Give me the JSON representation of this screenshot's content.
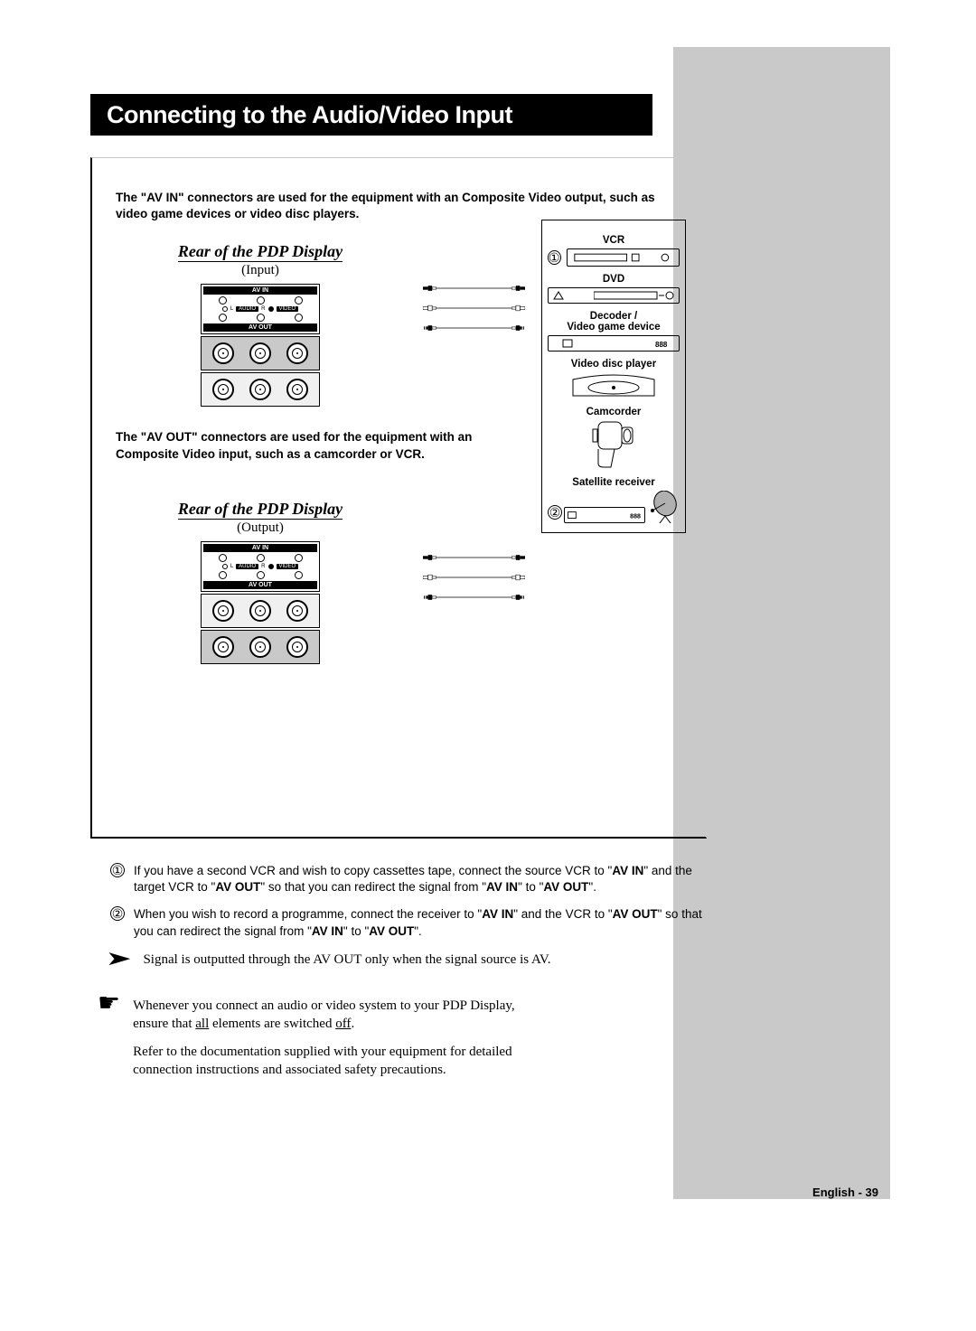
{
  "title": "Connecting to the Audio/Video Input",
  "intro_av_in": "The \"AV IN\" connectors are used for the equipment with an Composite Video output, such as video game devices or video disc players.",
  "intro_av_out": "The \"AV OUT\" connectors are used for the equipment with an Composite Video input, such as a camcorder or VCR.",
  "rear_label": "Rear of the PDP Display",
  "input_label": "(Input)",
  "output_label": "(Output)",
  "panel": {
    "av_in": "AV IN",
    "av_out": "AV OUT",
    "audio": "AUDIO",
    "video": "VIDEO",
    "l": "L",
    "r": "R"
  },
  "devices": {
    "vcr": "VCR",
    "dvd": "DVD",
    "decoder": "Decoder /\nVideo game device",
    "disc": "Video disc player",
    "camcorder": "Camcorder",
    "satellite": "Satellite receiver"
  },
  "note1_a": "If you have a second VCR and wish to copy cassettes tape, connect the source VCR to \"",
  "note1_b": "\" and the target VCR to \"",
  "note1_c": "\" so that you can redirect the signal from \"",
  "note1_d": "\" to \"",
  "note1_e": "\".",
  "note2_a": "When you wish to record a programme, connect the receiver to \"",
  "note2_b": "\" and the VCR to \"",
  "note2_c": "\" so that you can redirect the signal from \"",
  "note2_d": "\" to \"",
  "note2_e": "\".",
  "av_in_bold": "AV IN",
  "av_out_bold": "AV OUT",
  "signal_note": "Signal is outputted through the AV OUT only when the signal source is AV.",
  "tip_a": "Whenever you connect an audio or video system to your PDP Display, ensure that ",
  "tip_all": "all",
  "tip_b": " elements are switched ",
  "tip_off": "off",
  "tip_c": ".",
  "tip_para2": "Refer to the documentation supplied with your equipment for detailed connection instructions and associated safety precautions.",
  "footer": "English - 39"
}
